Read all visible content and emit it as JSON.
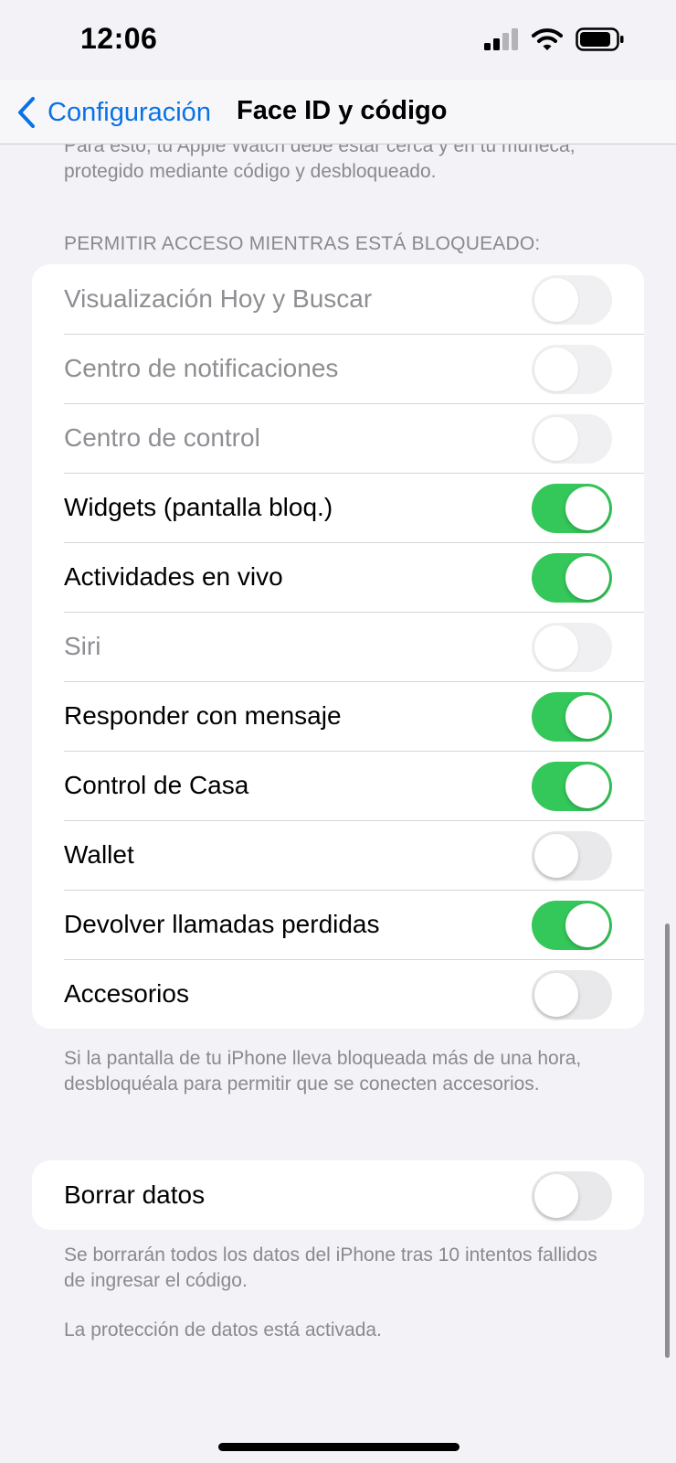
{
  "status_bar": {
    "time": "12:06",
    "icons": [
      "cellular-signal-icon",
      "wifi-icon",
      "battery-icon"
    ]
  },
  "nav": {
    "back_label": "Configuración",
    "title": "Face ID y código"
  },
  "cut_off_text": "Para esto, tu Apple Watch debe estar cerca y en tu muñeca, protegido mediante código y desbloqueado.",
  "section_header": "PERMITIR ACCESO MIENTRAS ESTÁ BLOQUEADO:",
  "access_rows": [
    {
      "label": "Visualización Hoy y Buscar",
      "on": false,
      "enabled": false
    },
    {
      "label": "Centro de notificaciones",
      "on": false,
      "enabled": false
    },
    {
      "label": "Centro de control",
      "on": false,
      "enabled": false
    },
    {
      "label": "Widgets (pantalla bloq.)",
      "on": true,
      "enabled": true
    },
    {
      "label": "Actividades en vivo",
      "on": true,
      "enabled": true
    },
    {
      "label": "Siri",
      "on": false,
      "enabled": false
    },
    {
      "label": "Responder con mensaje",
      "on": true,
      "enabled": true
    },
    {
      "label": "Control de Casa",
      "on": true,
      "enabled": true
    },
    {
      "label": "Wallet",
      "on": false,
      "enabled": true
    },
    {
      "label": "Devolver llamadas perdidas",
      "on": true,
      "enabled": true
    },
    {
      "label": "Accesorios",
      "on": false,
      "enabled": true
    }
  ],
  "accessories_footer": "Si la pantalla de tu iPhone lleva bloqueada más de una hora, desbloquéala para permitir que se conecten accesorios.",
  "erase_row": {
    "label": "Borrar datos",
    "on": false,
    "enabled": true
  },
  "erase_footer": "Se borrarán todos los datos del iPhone tras 10 intentos fallidos de ingresar el código.",
  "protection_footer": "La protección de datos está activada.",
  "colors": {
    "accent": "#0a72e5",
    "toggle_on": "#34c759",
    "toggle_off": "#e9e9eb",
    "background": "#f2f2f7"
  }
}
